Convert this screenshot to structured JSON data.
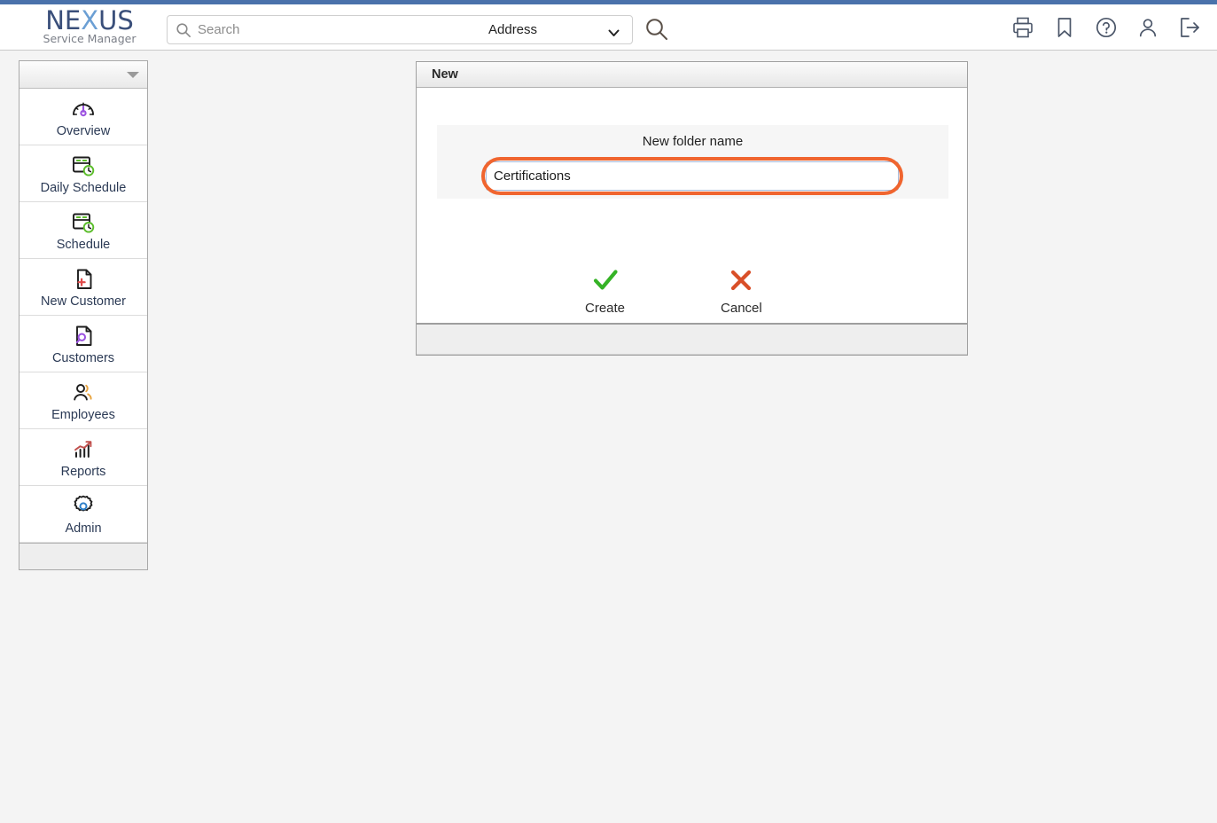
{
  "app": {
    "logo_primary_1": "NE",
    "logo_x": "X",
    "logo_primary_2": "US",
    "logo_subtitle": "Service Manager",
    "brand_navy": "#3a4f7a",
    "brand_blue": "#6b9fd4",
    "accent_bar_color": "#4a72ab",
    "annotation_color": "#f0652f"
  },
  "header": {
    "search": {
      "placeholder": "Search",
      "value": "",
      "icon": "search-icon",
      "scope_selected": "Address",
      "scope_options": [
        "Address"
      ],
      "submit_icon": "search-icon"
    },
    "icons": [
      {
        "name": "print-icon",
        "label": "Print"
      },
      {
        "name": "bookmark-icon",
        "label": "Bookmark"
      },
      {
        "name": "help-icon",
        "label": "Help"
      },
      {
        "name": "user-icon",
        "label": "User"
      },
      {
        "name": "logout-icon",
        "label": "Log out"
      }
    ]
  },
  "sidebar": {
    "collapse_icon": "chevron-down-icon",
    "items": [
      {
        "label": "Overview",
        "icon": "gauge-icon"
      },
      {
        "label": "Daily Schedule",
        "icon": "calendar-clock-icon"
      },
      {
        "label": "Schedule",
        "icon": "calendar-clock-icon"
      },
      {
        "label": "New Customer",
        "icon": "document-plus-icon"
      },
      {
        "label": "Customers",
        "icon": "document-search-icon"
      },
      {
        "label": "Employees",
        "icon": "people-icon"
      },
      {
        "label": "Reports",
        "icon": "bar-chart-trend-icon"
      },
      {
        "label": "Admin",
        "icon": "gear-icon"
      }
    ]
  },
  "dialog": {
    "title": "New",
    "field_label": "New folder name",
    "folder_name_value": "Certifications",
    "folder_name_placeholder": "",
    "create_label": "Create",
    "create_icon": "check-icon",
    "cancel_label": "Cancel",
    "cancel_icon": "x-icon"
  }
}
